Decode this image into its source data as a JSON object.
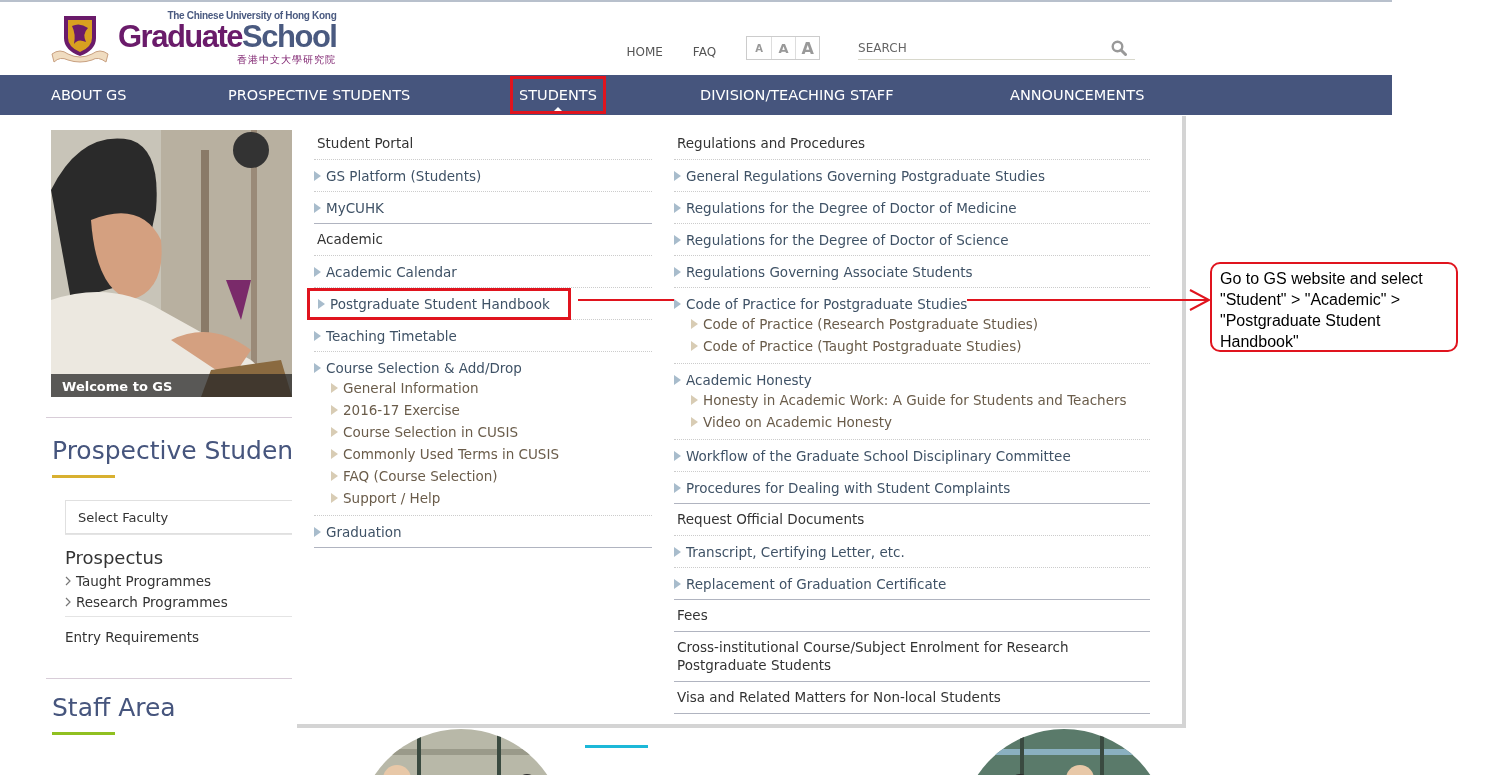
{
  "logo": {
    "university": "The Chinese University of Hong Kong",
    "name_first": "Graduate",
    "name_second": "School",
    "chinese": "香港中文大學研究院"
  },
  "top_links": [
    "HOME",
    "FAQ"
  ],
  "font_size_buttons": [
    "A",
    "A",
    "A"
  ],
  "search": {
    "placeholder": "SEARCH"
  },
  "nav": [
    {
      "label": "ABOUT GS",
      "selected": false,
      "annotated": false
    },
    {
      "label": "PROSPECTIVE STUDENTS",
      "selected": false,
      "annotated": false
    },
    {
      "label": "STUDENTS",
      "selected": true,
      "annotated": true
    },
    {
      "label": "DIVISION/TEACHING STAFF",
      "selected": false,
      "annotated": false
    },
    {
      "label": "ANNOUNCEMENTS",
      "selected": false,
      "annotated": false
    }
  ],
  "sidebar": {
    "banner": {
      "kind": "picture",
      "caption": "Welcome to GS"
    },
    "prospective_heading": "Prospective Studen",
    "faculty_select": {
      "placeholder": "Select Faculty"
    },
    "prospectus_heading": "Prospectus",
    "prospectus_links": [
      "Taught Programmes",
      "Research Programmes"
    ],
    "entry_link": "Entry Requirements",
    "staff_heading": "Staff Area"
  },
  "dropdown": [
    [
      {
        "heading": "Student Portal",
        "items": [
          {
            "label": "GS Platform (Students)",
            "annotated": false
          },
          {
            "label": "MyCUHK",
            "annotated": false
          }
        ]
      },
      {
        "heading": "Academic",
        "items": [
          {
            "label": "Academic Calendar",
            "annotated": false
          },
          {
            "label": "Postgraduate Student Handbook",
            "annotated": true
          },
          {
            "label": "Teaching Timetable",
            "annotated": false
          },
          {
            "label": "Course Selection & Add/Drop",
            "annotated": false,
            "children": [
              "General Information",
              "2016-17 Exercise",
              "Course Selection in CUSIS",
              "Commonly Used Terms in CUSIS",
              "FAQ (Course Selection)",
              "Support / Help"
            ]
          },
          {
            "label": "Graduation",
            "annotated": false
          }
        ]
      }
    ],
    [
      {
        "heading": "Regulations and Procedures",
        "items": [
          {
            "label": "General Regulations Governing Postgraduate Studies",
            "annotated": false
          },
          {
            "label": "Regulations for the Degree of Doctor of Medicine",
            "annotated": false
          },
          {
            "label": "Regulations for the Degree of Doctor of Science",
            "annotated": false
          },
          {
            "label": "Regulations Governing Associate Students",
            "annotated": false
          },
          {
            "label": "Code of Practice for Postgraduate Studies",
            "annotated": false,
            "children": [
              "Code of Practice (Research Postgraduate Studies)",
              "Code of Practice (Taught Postgraduate Studies)"
            ]
          },
          {
            "label": "Academic Honesty",
            "annotated": false,
            "children": [
              "Honesty in Academic Work: A Guide for Students and Teachers",
              "Video on Academic Honesty"
            ]
          },
          {
            "label": "Workflow of the Graduate School Disciplinary Committee",
            "annotated": false
          },
          {
            "label": "Procedures for Dealing with Student Complaints",
            "annotated": false
          }
        ]
      },
      {
        "heading": "Request Official Documents",
        "items": [
          {
            "label": "Transcript, Certifying Letter, etc.",
            "annotated": false
          },
          {
            "label": "Replacement of Graduation Certificate",
            "annotated": false
          }
        ]
      },
      {
        "heading": "Fees"
      },
      {
        "heading": "Cross-institutional Course/Subject Enrolment for Research Postgraduate Students"
      },
      {
        "heading": "Visa and Related Matters for Non-local Students"
      }
    ]
  ],
  "callout": {
    "text": "Go to GS website and select \"Student\" > \"Academic\" > \"Postgraduate Student Handbook\""
  }
}
